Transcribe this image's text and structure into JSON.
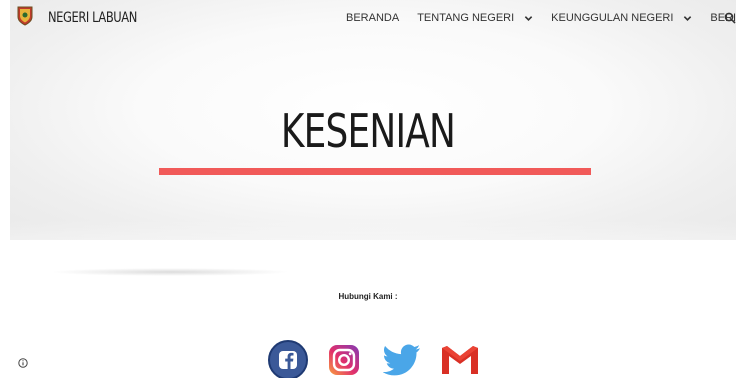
{
  "header": {
    "site_title": "NEGERI LABUAN",
    "nav": [
      {
        "label": "BERANDA",
        "has_dropdown": false
      },
      {
        "label": "TENTANG NEGERI",
        "has_dropdown": true
      },
      {
        "label": "KEUNGGULAN NEGERI",
        "has_dropdown": true
      },
      {
        "label": "BERITA",
        "has_dropdown": false
      }
    ]
  },
  "hero": {
    "title": "KESENIAN",
    "accent_color": "#f15a59"
  },
  "contact": {
    "label": "Hubungi Kami :",
    "icons": [
      "facebook-icon",
      "instagram-icon",
      "twitter-icon",
      "gmail-icon"
    ]
  }
}
